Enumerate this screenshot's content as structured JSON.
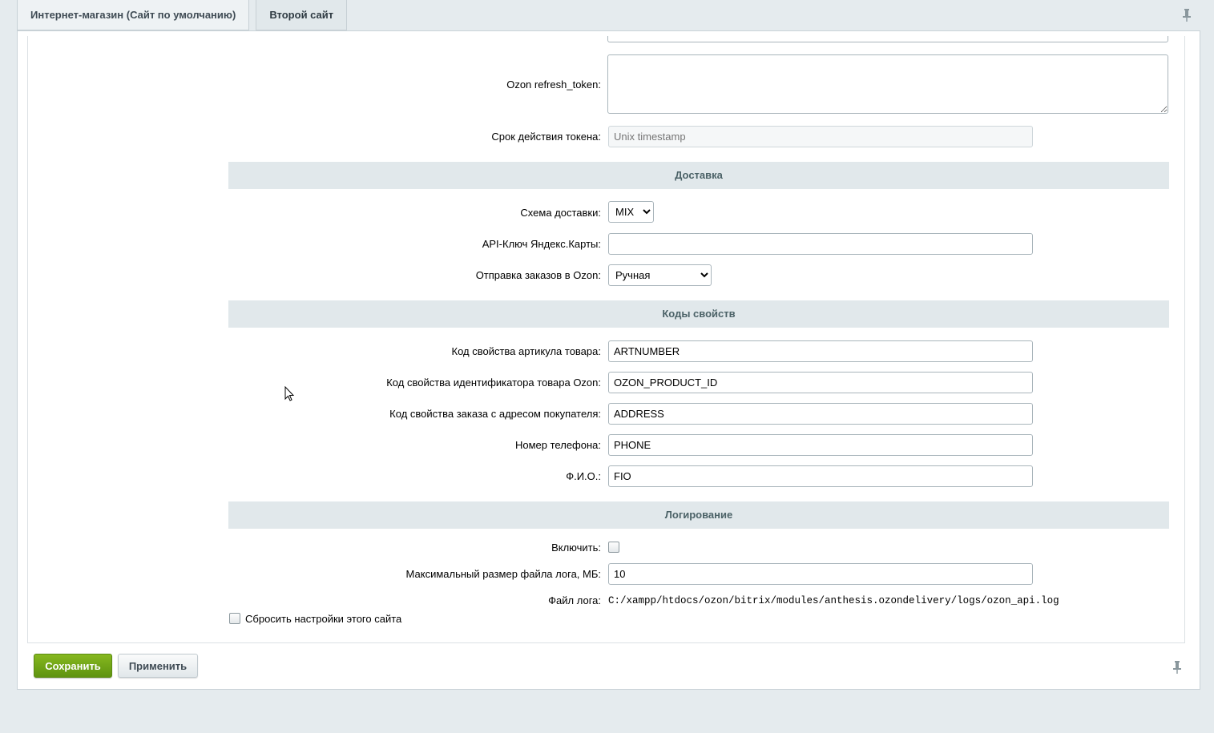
{
  "tabs": [
    {
      "label": "Интернет-магазин (Сайт по умолчанию)",
      "active": false
    },
    {
      "label": "Второй сайт",
      "active": true
    }
  ],
  "fields": {
    "refresh_token_label": "Ozon refresh_token:",
    "refresh_token_value": "",
    "token_expiry_label": "Срок действия токена:",
    "token_expiry_placeholder": "Unix timestamp"
  },
  "delivery": {
    "header": "Доставка",
    "scheme_label": "Схема доставки:",
    "scheme_value": "MIX",
    "yandex_key_label": "API-Ключ Яндекс.Карты:",
    "yandex_key_value": "",
    "send_orders_label": "Отправка заказов в Ozon:",
    "send_orders_value": "Ручная"
  },
  "codes": {
    "header": "Коды свойств",
    "article_label": "Код свойства артикула товара:",
    "article_value": "ARTNUMBER",
    "product_id_label": "Код свойства идентификатора товара Ozon:",
    "product_id_value": "OZON_PRODUCT_ID",
    "address_label": "Код свойства заказа с адресом покупателя:",
    "address_value": "ADDRESS",
    "phone_label": "Номер телефона:",
    "phone_value": "PHONE",
    "fio_label": "Ф.И.О.:",
    "fio_value": "FIO"
  },
  "logging": {
    "header": "Логирование",
    "enable_label": "Включить:",
    "max_size_label": "Максимальный размер файла лога, МБ:",
    "max_size_value": "10",
    "log_file_label": "Файл лога:",
    "log_file_path": "C:/xampp/htdocs/ozon/bitrix/modules/anthesis.ozondelivery/logs/ozon_api.log"
  },
  "reset_label": "Сбросить настройки этого сайта",
  "buttons": {
    "save": "Сохранить",
    "apply": "Применить"
  },
  "colors": {
    "save_button": "#6ea415",
    "section_header_bg": "#e1e8eb",
    "page_bg": "#e5ebee"
  },
  "icons": [
    "pin-icon",
    "cursor-icon"
  ]
}
